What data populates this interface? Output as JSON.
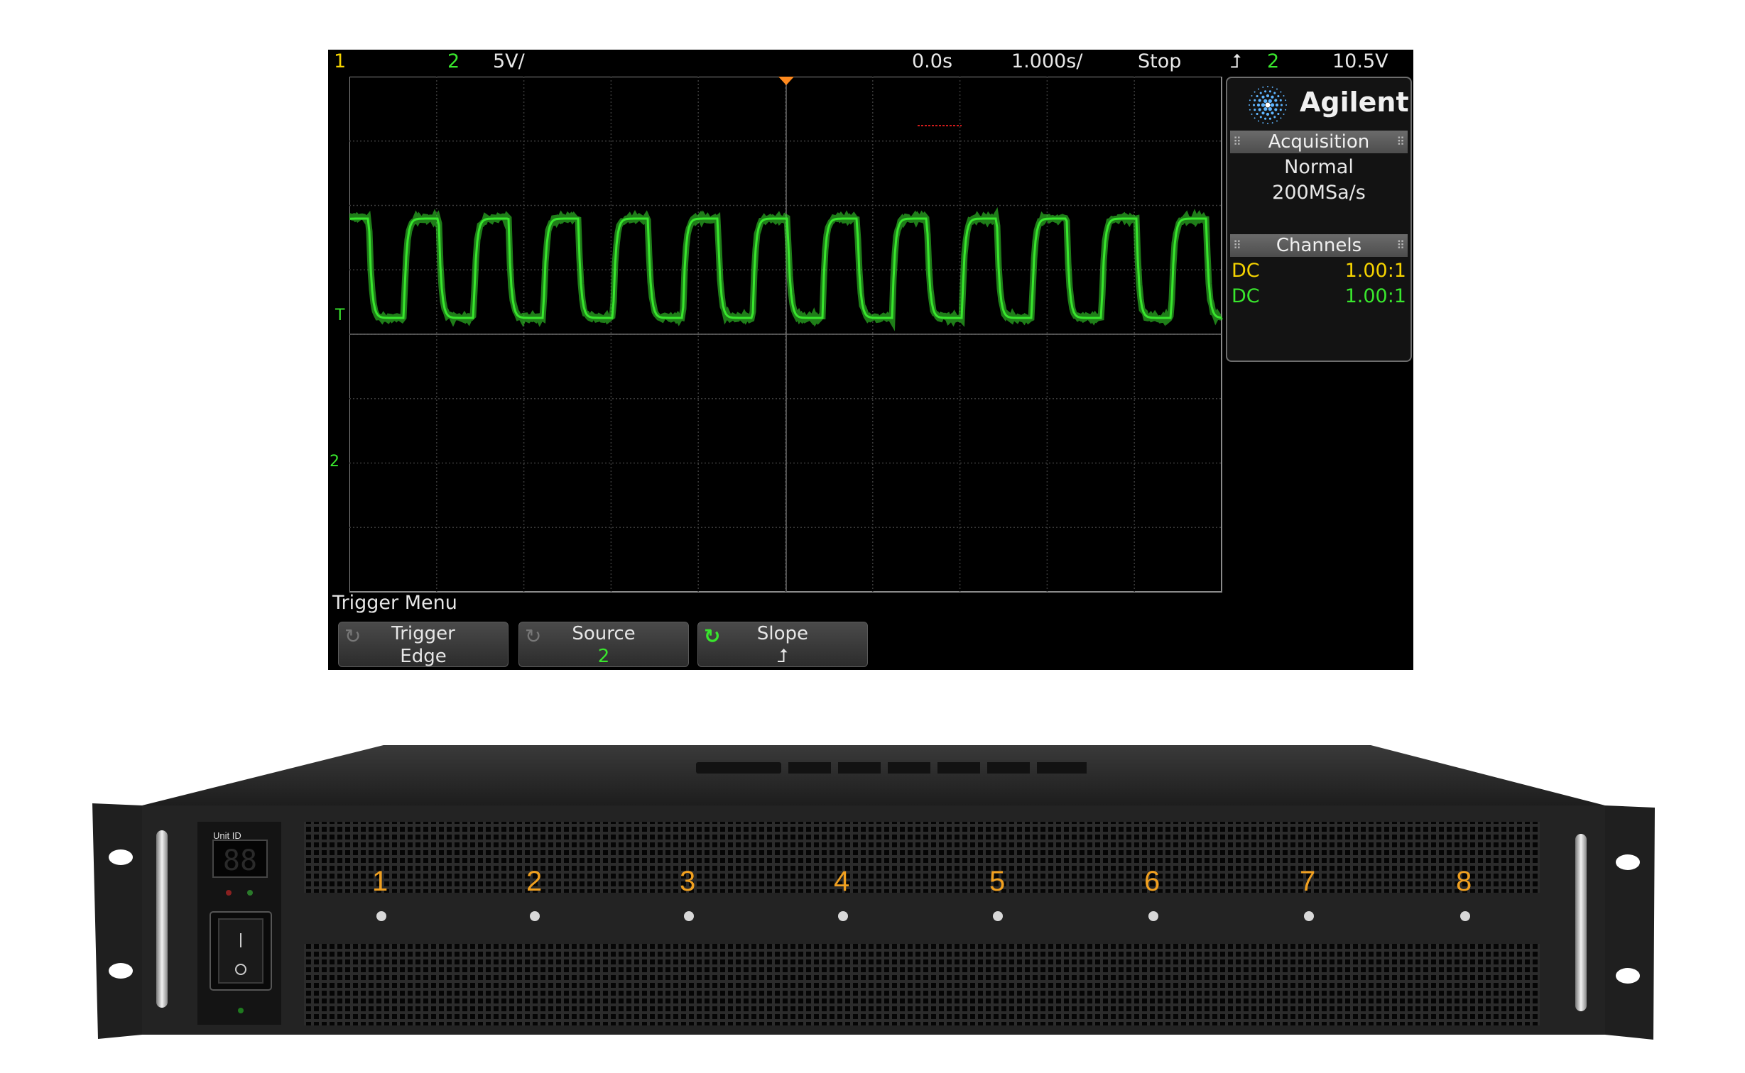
{
  "scope": {
    "topbar": {
      "ch1_label": "1",
      "ch2_label": "2",
      "ch2_scale": "5V/",
      "time_offset": "0.0s",
      "time_scale": "1.000s/",
      "run_state": "Stop",
      "trigger_source": "2",
      "trigger_level": "10.5V"
    },
    "brand": "Agilent",
    "acquisition": {
      "header": "Acquisition",
      "mode": "Normal",
      "sample_rate": "200MSa/s"
    },
    "channels": {
      "header": "Channels",
      "rows": [
        {
          "coupling": "DC",
          "probe": "1.00:1",
          "color": "#f5d300"
        },
        {
          "coupling": "DC",
          "probe": "1.00:1",
          "color": "#39e62d"
        }
      ]
    },
    "markers": {
      "trigger": "T",
      "ch2": "2"
    },
    "menu_title": "Trigger Menu",
    "softkeys": [
      {
        "label": "Trigger",
        "value": "Edge"
      },
      {
        "label": "Source",
        "value": "2"
      },
      {
        "label": "Slope",
        "value": "⮥"
      }
    ],
    "waveform_color": "#39e62d",
    "chart_data": {
      "type": "line",
      "series": [
        {
          "values": "square wave"
        }
      ],
      "cycles": 12.5,
      "grid": true
    }
  },
  "rack": {
    "unit_id_label": "Unit ID",
    "unit_id_display": "88",
    "ports": [
      "1",
      "2",
      "3",
      "4",
      "5",
      "6",
      "7",
      "8"
    ],
    "accent_color": "#f0a020"
  }
}
